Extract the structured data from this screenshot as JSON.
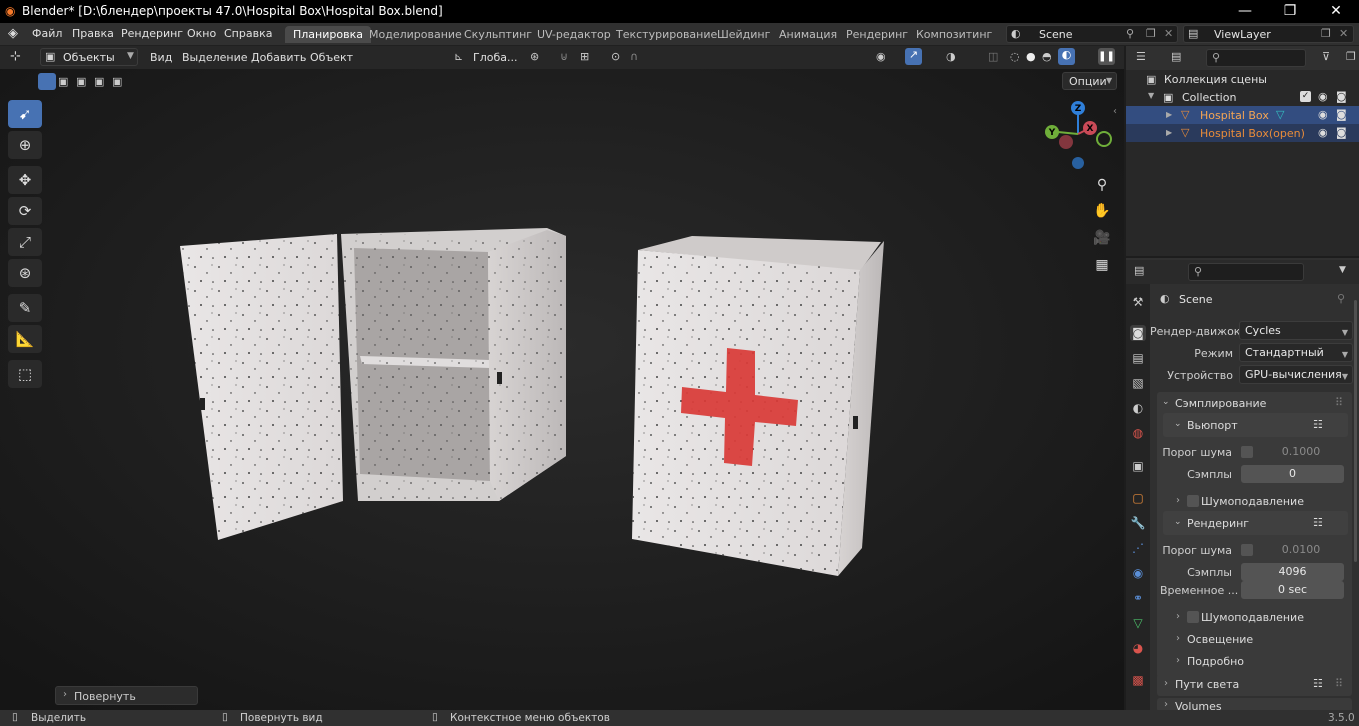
{
  "titlebar": {
    "title": "Blender* [D:\\блендер\\проекты 47.0\\Hospital Box\\Hospital Box.blend]",
    "minimize": "—",
    "maximize": "❐",
    "close": "✕"
  },
  "menus": [
    "Файл",
    "Правка",
    "Рендеринг",
    "Окно",
    "Справка"
  ],
  "workspaces": [
    "Планировка",
    "Моделирование",
    "Скульптинг",
    "UV-редактор",
    "Текстурирование",
    "Шейдинг",
    "Анимация",
    "Рендеринг",
    "Композитинг"
  ],
  "scene": {
    "name": "Scene",
    "view_layer": "ViewLayer"
  },
  "viewport_header": {
    "mode": "Объекты",
    "menus": [
      "Вид",
      "Выделение",
      "Добавить",
      "Объект"
    ],
    "transform": "Глоба...",
    "options": "Опции"
  },
  "viewport": {
    "last_op": "Повернуть",
    "gizmo": {
      "x": "X",
      "y": "Y",
      "z": "Z"
    }
  },
  "outliner": {
    "root": "Коллекция сцены",
    "collection": "Collection",
    "objects": [
      "Hospital Box",
      "Hospital Box(open)"
    ]
  },
  "properties": {
    "scene_label": "Scene",
    "render_engine_label": "Рендер-движок",
    "render_engine": "Cycles",
    "mode_label": "Режим",
    "mode": "Стандартный",
    "device_label": "Устройство",
    "device": "GPU-вычисления",
    "sampling": "Сэмплирование",
    "viewport": "Вьюпорт",
    "noise_threshold_label": "Порог шума",
    "vp_noise_threshold": "0.1000",
    "samples_label": "Сэмплы",
    "vp_samples": "0",
    "denoise": "Шумоподавление",
    "render": "Рендеринг",
    "r_noise_threshold": "0.0100",
    "r_samples": "4096",
    "time_label": "Временное ...",
    "time_value": "0 sec",
    "denoise2": "Шумоподавление",
    "lighting": "Освещение",
    "advanced": "Подробно",
    "light_paths": "Пути света",
    "volumes": "Volumes"
  },
  "status": {
    "select": "Выделить",
    "rotate_view": "Повернуть вид",
    "context_menu": "Контекстное меню объектов",
    "version": "3.5.0"
  }
}
